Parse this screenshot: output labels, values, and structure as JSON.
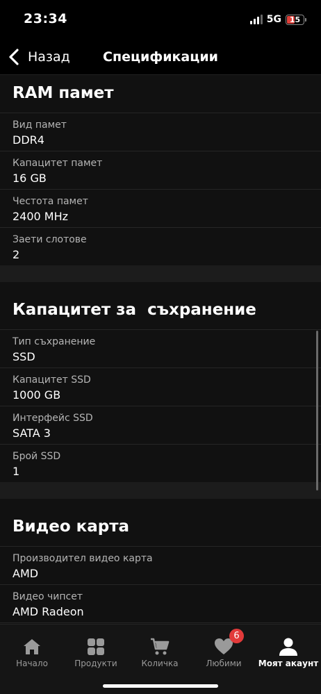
{
  "status_bar": {
    "time": "23:34",
    "network": "5G",
    "battery_level": "15",
    "battery_color": "#e0413b"
  },
  "header": {
    "back_label": "Назад",
    "title": "Спецификации"
  },
  "sections": [
    {
      "title": "RAM памет",
      "rows": [
        {
          "label": "Вид памет",
          "value": "DDR4"
        },
        {
          "label": "Капацитет памет",
          "value": "16 GB"
        },
        {
          "label": "Честота памет",
          "value": "2400 MHz"
        },
        {
          "label": "Заети слотове",
          "value": "2"
        }
      ]
    },
    {
      "title": "Капацитет за  съхранение",
      "rows": [
        {
          "label": "Тип съхранение",
          "value": "SSD"
        },
        {
          "label": "Капацитет SSD",
          "value": "1000 GB"
        },
        {
          "label": "Интерфейс SSD",
          "value": "SATA 3"
        },
        {
          "label": "Брой SSD",
          "value": "1"
        }
      ]
    },
    {
      "title": "Видео карта",
      "rows": [
        {
          "label": "Производител видео карта",
          "value": "AMD"
        },
        {
          "label": "Видео чипсет",
          "value": "AMD Radeon"
        }
      ]
    }
  ],
  "tab_bar": {
    "items": [
      {
        "label": "Начало",
        "icon": "home-icon"
      },
      {
        "label": "Продукти",
        "icon": "grid-icon"
      },
      {
        "label": "Количка",
        "icon": "cart-icon"
      },
      {
        "label": "Любими",
        "icon": "heart-icon",
        "badge": "6"
      },
      {
        "label": "Моят акаунт",
        "icon": "user-icon",
        "active": true
      }
    ],
    "badge_color": "#e23a3a"
  }
}
